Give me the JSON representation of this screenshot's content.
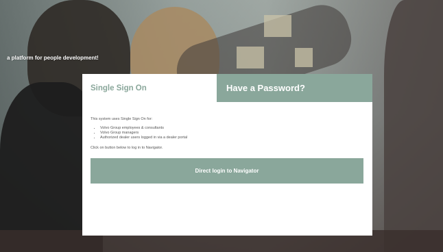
{
  "tagline": "a platform for people development!",
  "tabs": {
    "sso_label": "Single Sign On",
    "password_label": "Have a Password?"
  },
  "sso": {
    "intro": "This system uses Single Sign On for:",
    "items": [
      "Volvo Group employees & consultants",
      "Volvo Group managers",
      "Authorized dealer users logged in via a dealer portal"
    ],
    "hint": "Click on button below to log in to Navigator.",
    "button_label": "Direct login to Navigator"
  },
  "colors": {
    "accent": "#8aa79b",
    "panel_bg": "#ffffff"
  }
}
